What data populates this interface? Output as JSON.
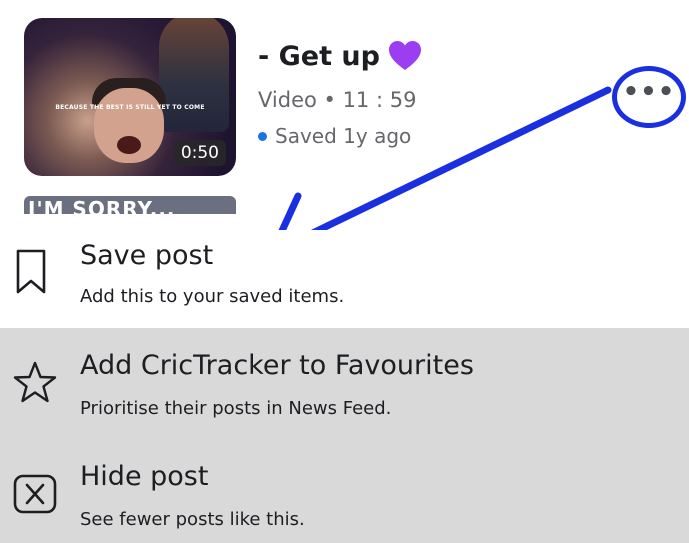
{
  "post": {
    "title": "- Get up",
    "title_emoji_icon": "purple-heart-icon",
    "meta": "Video • 11 : 59",
    "saved": "Saved 1y ago",
    "saved_dot_color": "#1b74e4",
    "thumbnail_caption": "BECAUSE THE BEST IS STILL YET TO COME",
    "duration": "0:50",
    "more_icon": "more-options-icon",
    "more_label": "•••"
  },
  "next_card_strip_text": "I'M SORRY...",
  "annotation_color": "#1a2fe0",
  "menu": {
    "items": [
      {
        "icon": "bookmark-icon",
        "title": "Save post",
        "subtitle": "Add this to your saved items."
      },
      {
        "icon": "star-icon",
        "title": "Add CricTracker to Favourites",
        "subtitle": "Prioritise their posts in News Feed."
      },
      {
        "icon": "close-box-icon",
        "title": "Hide post",
        "subtitle": "See fewer posts like this."
      }
    ]
  }
}
